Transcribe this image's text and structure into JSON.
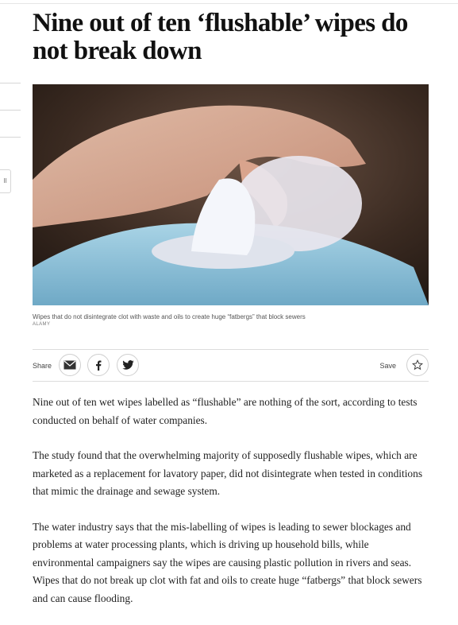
{
  "headline": "Nine out of ten ‘flushable’ wipes do not break down",
  "side_button_label": "ll",
  "hero_image": {
    "caption": "Wipes that do not disintegrate clot with waste and oils to create huge “fatbergs” that block sewers",
    "credit": "ALAMY"
  },
  "share_bar": {
    "share_label": "Share",
    "save_label": "Save",
    "icons": [
      "email-icon",
      "facebook-icon",
      "twitter-icon",
      "star-icon"
    ]
  },
  "article": {
    "paragraphs": [
      "Nine out of ten wet wipes labelled as “flushable” are nothing of the sort, according to tests conducted on behalf of water companies.",
      "The study found that the overwhelming majority of supposedly flushable wipes, which are marketed as a replacement for lavatory paper, did not disintegrate when tested in conditions that mimic the drainage and sewage system.",
      "The water industry says that the mis-labelling of wipes is leading to sewer blockages and problems at water processing plants, which is driving up household bills, while environmental campaigners say the wipes are causing plastic pollution in rivers and seas. Wipes that do not break up clot with fat and oils to create huge “fatbergs” that block sewers and can cause flooding."
    ]
  }
}
